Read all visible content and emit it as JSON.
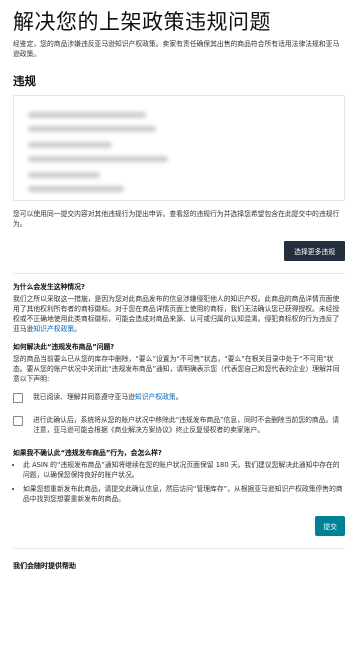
{
  "page": {
    "title": "解决您的上架政策违规问题",
    "intro": "经鉴定，您的商品涉嫌违反亚马逊知识产权政策。卖家有责任确保其出售的商品符合所有适用法律法规和亚马逊政策。"
  },
  "violation": {
    "heading": "违规",
    "appeal_note": "您可以使用同一提交内容对其他违规行为提出申诉。查看您的违规行为并选择您希望包含在此提交中的违规行为。",
    "button": "选择更多违规"
  },
  "why": {
    "heading": "为什么会发生这种情况?",
    "text_before_link": "我们之所以采取这一措施，是因为您对此商品发布的信息涉嫌侵犯他人的知识产权。此商品的商品详情页面使用了其他权利所有者的商标徽标。对于您在商品详情页面上使用的商标，我们无法确认您已获得授权。未经授权或不正确地使用此类商标徽标，可能会造成对商品来源、认可或归属的认知混淆。侵犯商标权的行为违反了亚马逊",
    "link": "知识产权政策",
    "text_after_link": "。"
  },
  "resolve": {
    "heading": "如何解决此“违规发布商品”问题?",
    "text": "您的商品当前要么已从您的库存中删除，“要么”设置为“不可售”状态，“要么”在根关目录中处于“不可用”状态。要从您的账户状况中关闭此“违规发布商品”通知，请明确表示您（代表您自己和您代表的企业）理解并同意以下声明:"
  },
  "checks": [
    {
      "text_before_link": "我已阅读、理解并同意遵守亚马逊",
      "link": "知识产权政策",
      "text_after_link": "。"
    },
    {
      "text": "进行此确认后，系统将从您的账户状况中移除此“违规发布商品”信息，同时不会删除当前您的商品。请注意，亚马逊可能会根据《商业解决方案协议》终止反复侵权者的卖家账户。"
    }
  ],
  "repeat": {
    "heading": "如果我不确认此“违规发布商品”行为，会怎么样?",
    "bullets": [
      "此 ASIN 的“违规发布商品”通知将继续在您的账户状况页面保留 180 天。我们建议您解决此通知中存在的问题，以确保您保持良好的账户状况。",
      "如果您想重新发布此商品，请提交此确认信息，然后访问“管理库存”，从根据亚马逊知识产权政策停售的商品中找到您想要重新发布的商品。"
    ]
  },
  "submit_label": "提交",
  "help_heading": "我们会随时提供帮助"
}
